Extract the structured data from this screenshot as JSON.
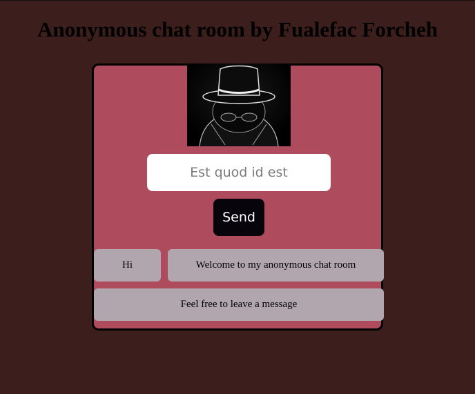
{
  "page": {
    "title": "Anonymous chat room by Fualefac Forcheh"
  },
  "avatar": {
    "icon": "incognito-hat-avatar-icon"
  },
  "composer": {
    "placeholder": "Est quod id est",
    "value": "",
    "send_label": "Send"
  },
  "messages": [
    {
      "text": "Hi"
    },
    {
      "text": "Welcome to my anonymous chat room"
    },
    {
      "text": "Feel free to leave a message"
    }
  ],
  "colors": {
    "background": "#3c1e1c",
    "panel": "#ae4b5c",
    "bubble": "#b1a6ae",
    "send_button": "#07040c"
  }
}
